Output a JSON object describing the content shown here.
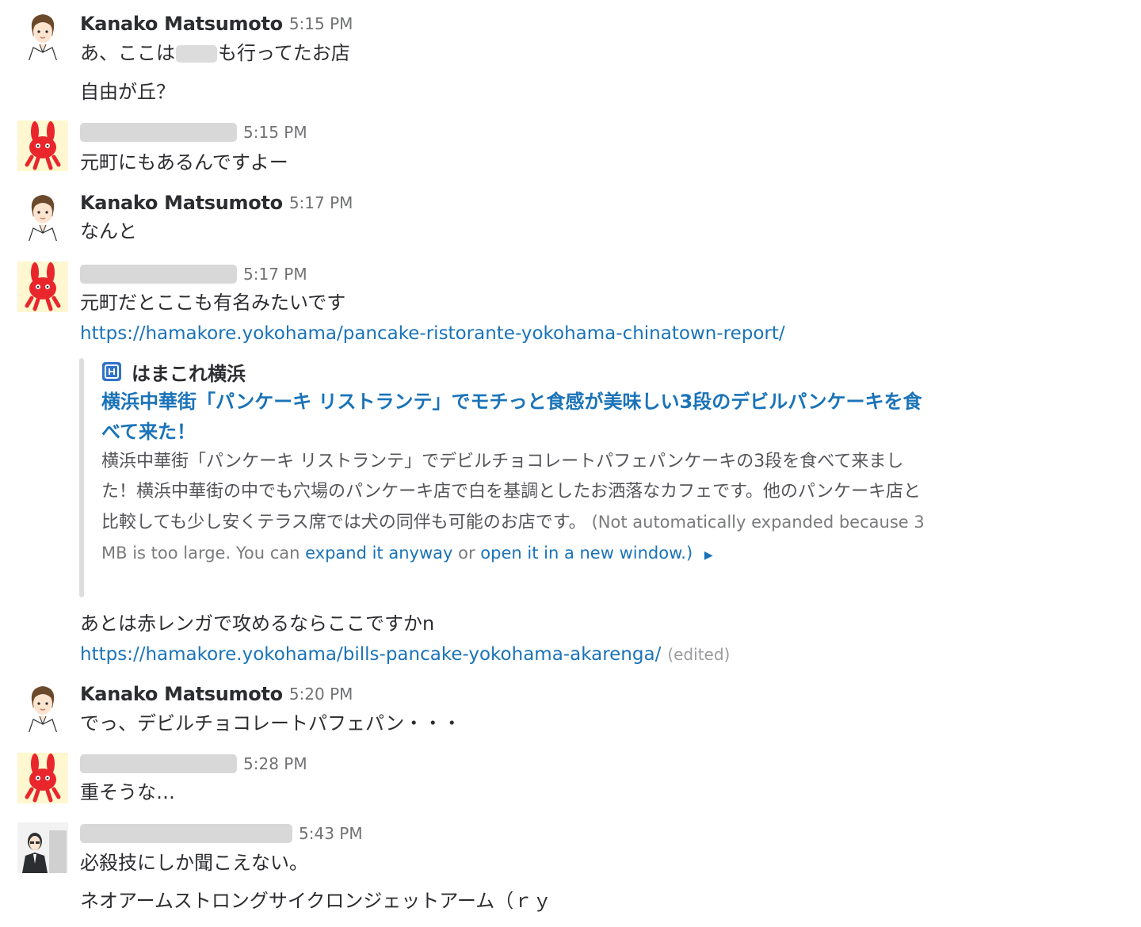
{
  "messages": [
    {
      "user": "Kanako Matsumoto",
      "time": "5:15 PM",
      "lines": [
        "あ、ここは",
        "も行ってたお店",
        "自由が丘？"
      ]
    },
    {
      "user": "",
      "time": "5:15 PM",
      "lines": [
        "元町にもあるんですよー"
      ]
    },
    {
      "user": "Kanako Matsumoto",
      "time": "5:17 PM",
      "lines": [
        "なんと"
      ]
    },
    {
      "user": "",
      "time": "5:17 PM",
      "lines": [
        "元町だとここも有名みたいです",
        "あとは赤レンガで攻めるならここですかn"
      ],
      "links": [
        "https://hamakore.yokohama/pancake-ristorante-yokohama-chinatown-report/",
        "https://hamakore.yokohama/bills-pancake-yokohama-akarenga/"
      ],
      "edited": "(edited)",
      "attachment": {
        "site": "はまこれ横浜",
        "title": "横浜中華街「パンケーキ リストランテ」でモチっと食感が美味しい3段のデビルパンケーキを食べて来た！",
        "description": "横浜中華街「パンケーキ リストランテ」でデビルチョコレートパフェパンケーキの3段を食べて来ました！横浜中華街の中でも穴場のパンケーキ店で白を基調としたお洒落なカフェです。他のパンケーキ店と比較しても少し安くテラス席では犬の同伴も可能のお店です。",
        "note_prefix": "(Not automatically expanded because 3 MB is too large. You can",
        "note_expand": "expand it anyway",
        "note_or": "or",
        "note_open": "open it in a new window.",
        "note_suffix": ")"
      }
    },
    {
      "user": "Kanako Matsumoto",
      "time": "5:20 PM",
      "lines": [
        "でっ、デビルチョコレートパフェパン・・・"
      ]
    },
    {
      "user": "",
      "time": "5:28 PM",
      "lines": [
        "重そうな…"
      ]
    },
    {
      "user": "",
      "time": "5:43 PM",
      "lines": [
        "必殺技にしか聞こえない。",
        "ネオアームストロングサイクロンジェットアーム（ｒｙ"
      ]
    }
  ],
  "icons": {
    "toggle": "triangle-right-icon",
    "site": "site-favicon-icon"
  },
  "colors": {
    "link": "#1a73b8",
    "text": "#2c2d30",
    "time": "#717274",
    "avatar_bg": "#fff7cf",
    "rabbit": "#e8262c"
  }
}
